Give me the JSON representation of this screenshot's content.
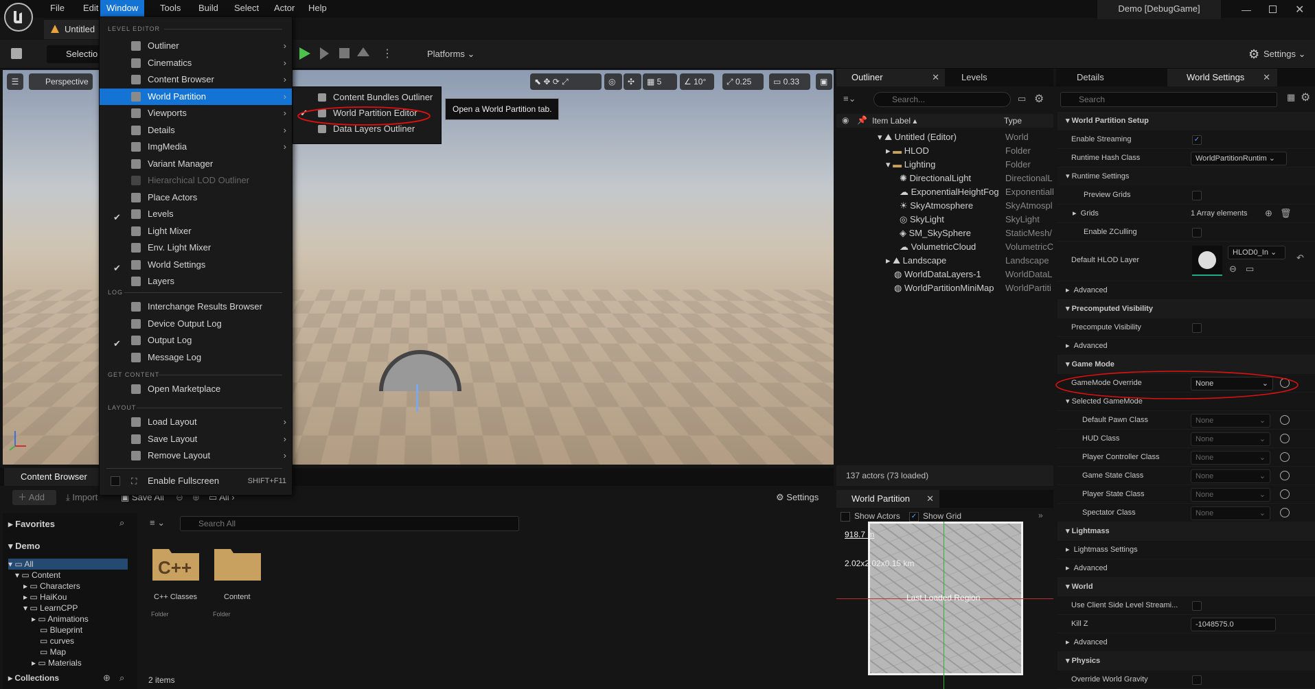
{
  "titlebar": {
    "menu": [
      "File",
      "Edit",
      "Window",
      "Tools",
      "Build",
      "Select",
      "Actor",
      "Help"
    ],
    "active_menu": "Window",
    "project": "Demo [DebugGame]",
    "doc_tab": "Untitled"
  },
  "toolbar": {
    "selection_label": "Selectio",
    "platforms_label": "Platforms",
    "settings_label": "Settings"
  },
  "viewport": {
    "perspective_label": "Perspective",
    "grid_snap": "5",
    "rotation_snap": "10°",
    "scale_snap": "0.25",
    "camera_speed": "0.33"
  },
  "window_menu": {
    "section_level_editor": "LEVEL EDITOR",
    "level_editor_items": [
      {
        "label": "Outliner",
        "submenu": true,
        "checked": false,
        "disabled": false
      },
      {
        "label": "Cinematics",
        "submenu": true,
        "checked": false,
        "disabled": false
      },
      {
        "label": "Content Browser",
        "submenu": true,
        "checked": false,
        "disabled": false
      },
      {
        "label": "World Partition",
        "submenu": true,
        "checked": false,
        "disabled": false,
        "selected": true
      },
      {
        "label": "Viewports",
        "submenu": true,
        "checked": false,
        "disabled": false
      },
      {
        "label": "Details",
        "submenu": true,
        "checked": false,
        "disabled": false
      },
      {
        "label": "ImgMedia",
        "submenu": true,
        "checked": false,
        "disabled": false
      },
      {
        "label": "Variant Manager",
        "submenu": false,
        "checked": false,
        "disabled": false
      },
      {
        "label": "Hierarchical LOD Outliner",
        "submenu": false,
        "checked": false,
        "disabled": true
      },
      {
        "label": "Place Actors",
        "submenu": false,
        "checked": false,
        "disabled": false
      },
      {
        "label": "Levels",
        "submenu": false,
        "checked": true,
        "disabled": false
      },
      {
        "label": "Light Mixer",
        "submenu": false,
        "checked": false,
        "disabled": false
      },
      {
        "label": "Env. Light Mixer",
        "submenu": false,
        "checked": false,
        "disabled": false
      },
      {
        "label": "World Settings",
        "submenu": false,
        "checked": true,
        "disabled": false
      },
      {
        "label": "Layers",
        "submenu": false,
        "checked": false,
        "disabled": false
      }
    ],
    "section_log": "LOG",
    "log_items": [
      {
        "label": "Interchange Results Browser",
        "checked": false
      },
      {
        "label": "Device Output Log",
        "checked": false
      },
      {
        "label": "Output Log",
        "checked": true
      },
      {
        "label": "Message Log",
        "checked": false
      }
    ],
    "section_get_content": "GET CONTENT",
    "get_content_items": [
      {
        "label": "Open Marketplace"
      }
    ],
    "section_layout": "LAYOUT",
    "layout_items": [
      {
        "label": "Load Layout"
      },
      {
        "label": "Save Layout"
      },
      {
        "label": "Remove Layout"
      }
    ],
    "fullscreen_label": "Enable Fullscreen",
    "fullscreen_shortcut": "SHIFT+F11"
  },
  "world_partition_submenu": [
    {
      "label": "Content Bundles Outliner",
      "checked": false
    },
    {
      "label": "World Partition Editor",
      "checked": true
    },
    {
      "label": "Data Layers Outliner",
      "checked": false
    }
  ],
  "tooltip": "Open a World Partition tab.",
  "outliner": {
    "tab_outliner": "Outliner",
    "tab_levels": "Levels",
    "search_placeholder": "Search...",
    "col_label": "Item Label",
    "col_type": "Type",
    "rows": [
      {
        "label": "Untitled (Editor)",
        "type": "World"
      },
      {
        "label": "HLOD",
        "type": "Folder"
      },
      {
        "label": "Lighting",
        "type": "Folder"
      },
      {
        "label": "DirectionalLight",
        "type": "DirectionalL"
      },
      {
        "label": "ExponentialHeightFog",
        "type": "Exponentiall"
      },
      {
        "label": "SkyAtmosphere",
        "type": "SkyAtmospl"
      },
      {
        "label": "SkyLight",
        "type": "SkyLight"
      },
      {
        "label": "SM_SkySphere",
        "type": "StaticMesh/"
      },
      {
        "label": "VolumetricCloud",
        "type": "VolumetricC"
      },
      {
        "label": "Landscape",
        "type": "Landscape"
      },
      {
        "label": "WorldDataLayers-1",
        "type": "WorldDataL"
      },
      {
        "label": "WorldPartitionMiniMap",
        "type": "WorldPartiti"
      }
    ],
    "status": "137 actors (73 loaded)"
  },
  "world_partition_panel": {
    "tab": "World Partition",
    "show_actors": "Show Actors",
    "show_grid": "Show Grid",
    "scale": "918.7 m",
    "size": "2.02x2.02x0.15 km",
    "region_label": "Last Loaded Region"
  },
  "details": {
    "tab_details": "Details",
    "tab_world_settings": "World Settings",
    "search_placeholder": "Search",
    "sections": {
      "world_partition_setup": "World Partition Setup",
      "enable_streaming": "Enable Streaming",
      "runtime_hash_class": "Runtime Hash Class",
      "runtime_hash_value": "WorldPartitionRuntim",
      "runtime_settings": "Runtime Settings",
      "preview_grids": "Preview Grids",
      "grids": "Grids",
      "grids_value": "1 Array elements",
      "enable_zculling": "Enable ZCulling",
      "default_hlod_layer": "Default HLOD Layer",
      "hlod_value": "HLOD0_In",
      "advanced": "Advanced",
      "precomputed_visibility": "Precomputed Visibility",
      "precompute_visibility": "Precompute Visibility",
      "game_mode": "Game Mode",
      "gamemode_override": "GameMode Override",
      "gamemode_override_value": "None",
      "selected_gamemode": "Selected GameMode",
      "default_pawn_class": "Default Pawn Class",
      "hud_class": "HUD Class",
      "player_controller_class": "Player Controller Class",
      "game_state_class": "Game State Class",
      "player_state_class": "Player State Class",
      "spectator_class": "Spectator Class",
      "none": "None",
      "lightmass": "Lightmass",
      "lightmass_settings": "Lightmass Settings",
      "world": "World",
      "use_client_side": "Use Client Side Level Streami...",
      "kill_z": "Kill Z",
      "kill_z_value": "-1048575.0",
      "physics": "Physics",
      "override_world_gravity": "Override World Gravity"
    }
  },
  "content_browser": {
    "tab": "Content Browser",
    "add": "Add",
    "import": "Import",
    "save_all": "Save All",
    "path_all": "All",
    "settings": "Settings",
    "favorites": "Favorites",
    "demo": "Demo",
    "collections": "Collections",
    "tree": [
      "All",
      "Content",
      "Characters",
      "HaiKou",
      "LearnCPP",
      "Animations",
      "Blueprint",
      "curves",
      "Map",
      "Materials"
    ],
    "search_placeholder": "Search All",
    "items": [
      {
        "name": "C++ Classes",
        "kind": "Folder"
      },
      {
        "name": "Content",
        "kind": "Folder"
      }
    ],
    "item_count": "2 items"
  },
  "colors": {
    "accent": "#1474d6",
    "annotation": "#e01010",
    "folder": "#c8a060"
  }
}
